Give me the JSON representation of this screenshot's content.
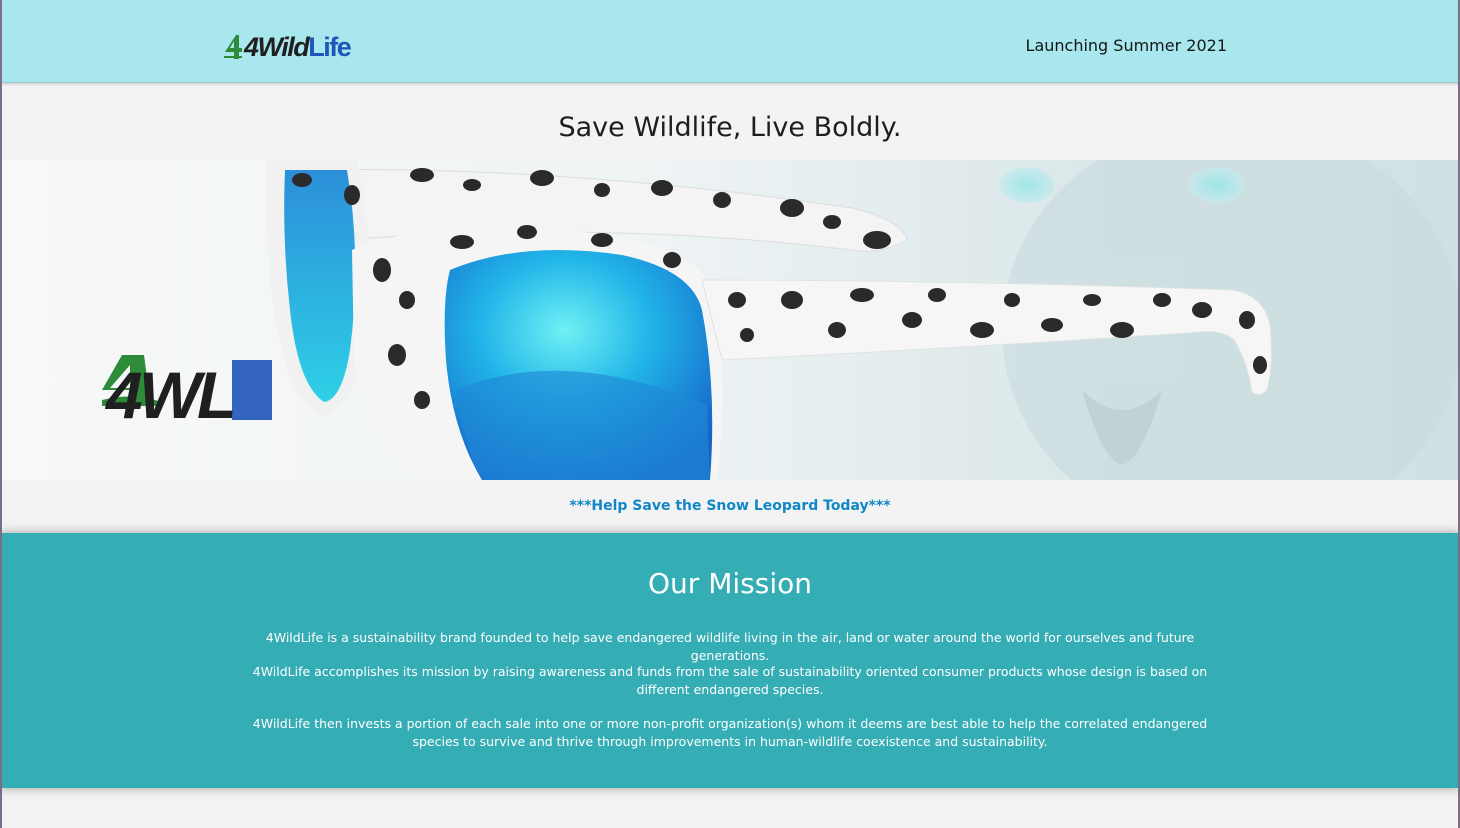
{
  "header": {
    "logo_text_part1": "4Wild",
    "logo_text_part2": "Life",
    "launch_text": "Launching Summer 2021"
  },
  "tagline": "Save Wildlife, Live Boldly.",
  "hero": {
    "logo_text": "4WL"
  },
  "help_link": "***Help Save the Snow Leopard Today***",
  "mission": {
    "heading": "Our Mission",
    "paragraphs": [
      "4WildLife is a sustainability brand founded to help save endangered wildlife living in the air, land or water around the world for ourselves and future generations.",
      "4WildLife accomplishes its mission by raising awareness and funds from the sale of sustainability oriented consumer products whose design is based on different endangered species.",
      "4WildLife then invests a portion of each sale into one or more non-profit organization(s) whom it deems are best able to help the correlated endangered species to survive and thrive through improvements in human-wildlife coexistence and sustainability."
    ]
  },
  "colors": {
    "header_bg": "#a8e7ee",
    "mission_bg": "#35adb5",
    "link": "#1287c8",
    "logo_green": "#2e8b3a",
    "logo_blue": "#1f54b8"
  }
}
